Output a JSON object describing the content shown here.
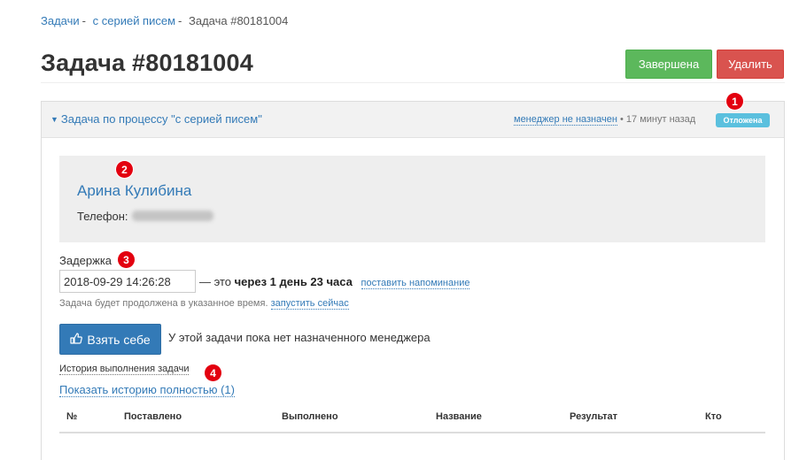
{
  "breadcrumb": {
    "items": [
      "Задачи",
      "с серией писем"
    ],
    "separator": "-",
    "current": "Задача #80181004"
  },
  "page": {
    "title": "Задача #80181004"
  },
  "actions": {
    "done_label": "Завершена",
    "delete_label": "Удалить"
  },
  "panel": {
    "title": "Задача по процессу \"с серией писем\"",
    "manager_link": "менеджер не назначен",
    "time_ago": "• 17 минут назад",
    "status_badge": "Отложена"
  },
  "contact": {
    "name": "Арина Кулибина",
    "phone_label": "Телефон:"
  },
  "delay": {
    "label": "Задержка",
    "value": "2018-09-29 14:26:28",
    "text_prefix": "— это",
    "text_bold": "через 1 день 23 часа",
    "remind_link": "поставить напоминание",
    "note": "Задача будет продолжена в указанное время.",
    "run_now_link": "запустить сейчас"
  },
  "assign": {
    "button_label": "Взять себе",
    "no_manager_text": "У этой задачи пока нет назначенного менеджера"
  },
  "history": {
    "title": "История выполнения задачи",
    "show_full_link": "Показать историю полностью (1)",
    "columns": [
      "№",
      "Поставлено",
      "Выполнено",
      "Название",
      "Результат",
      "Кто"
    ]
  },
  "markers": [
    "1",
    "2",
    "3",
    "4"
  ],
  "colors": {
    "success": "#5cb85c",
    "danger": "#d9534f",
    "primary": "#337ab7",
    "info_badge": "#5bc0de",
    "marker": "#e3000f"
  }
}
